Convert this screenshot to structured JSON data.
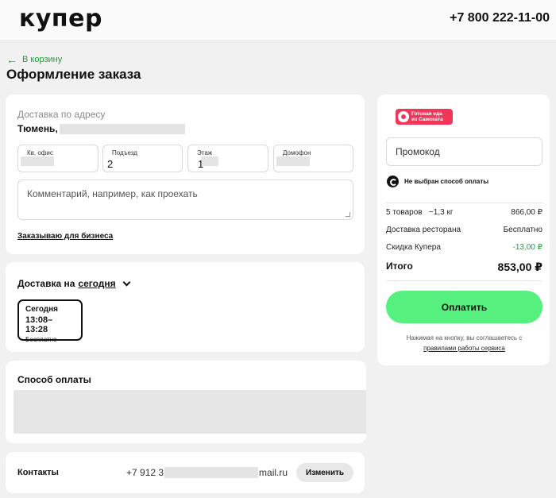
{
  "header": {
    "logo": "купер",
    "phone": "+7 800 222-11-00"
  },
  "nav": {
    "back_label": "В корзину",
    "back_arrow": "←"
  },
  "page_title": "Оформление заказа",
  "address": {
    "label": "Доставка по адресу",
    "city": "Тюмень,",
    "fields": [
      {
        "label": "Кв, офис",
        "value": ""
      },
      {
        "label": "Подъезд",
        "value": "2"
      },
      {
        "label": "Этаж",
        "value": "1"
      },
      {
        "label": "Домофон",
        "value": ""
      }
    ],
    "comment_placeholder": "Комментарий, например, как проехать",
    "business_link": "Заказываю для бизнеса"
  },
  "delivery": {
    "title_prefix": "Доставка на",
    "day_link": "сегодня",
    "slot": {
      "day": "Сегодня",
      "time": "13:08–13:28",
      "price": "Бесплатно"
    }
  },
  "payment": {
    "title": "Способ оплаты"
  },
  "contacts": {
    "label": "Контакты",
    "phone_prefix": "+7 912 3",
    "email_suffix": "mail.ru",
    "change_button": "Изменить"
  },
  "summary": {
    "badge_line1": "Готовая еда",
    "badge_line2": "из Самоката",
    "promo_placeholder": "Промокод",
    "payment_method": "Не выбран способ оплаты",
    "items_label": "5 товаров",
    "items_weight": "~1,3 кг",
    "items_price": "866,00 ₽",
    "delivery_label": "Доставка ресторана",
    "delivery_price": "Бесплатно",
    "discount_label": "Скидка Купера",
    "discount_value": "-13,00 ₽",
    "total_label": "Итого",
    "total_value": "853,00 ₽",
    "pay_button": "Оплатить",
    "agree_text": "Нажимая на кнопку, вы соглашаетесь с",
    "rules_link": "правилами работы сервиса"
  },
  "colors": {
    "accent_green": "#55f07e",
    "link_green": "#1f9d3a",
    "badge_pink": "#f0375a"
  }
}
